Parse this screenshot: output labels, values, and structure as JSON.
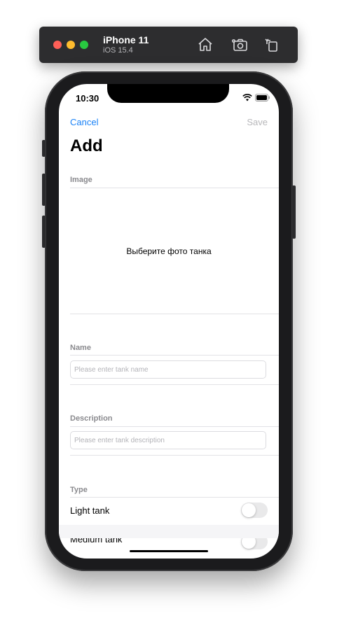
{
  "simulator": {
    "device_name": "iPhone 11",
    "os_version": "iOS 15.4",
    "tools": [
      "home-icon",
      "screenshot-icon",
      "rotate-icon"
    ]
  },
  "status_bar": {
    "time": "10:30",
    "icons": [
      "wifi-icon",
      "battery-icon"
    ]
  },
  "nav": {
    "cancel_label": "Cancel",
    "save_label": "Save",
    "accent_color": "#1a82f7",
    "disabled_color": "#b8b8bb"
  },
  "title": "Add",
  "sections": {
    "image": {
      "header": "Image",
      "placeholder": "Выберите фото танка"
    },
    "name": {
      "header": "Name",
      "field_placeholder": "Please enter tank name",
      "field_value": ""
    },
    "description": {
      "header": "Description",
      "field_placeholder": "Please enter tank description",
      "field_value": ""
    },
    "type": {
      "header": "Type",
      "options": [
        {
          "label": "Light tank",
          "enabled": false
        },
        {
          "label": "Medium tank",
          "enabled": false
        }
      ]
    }
  }
}
